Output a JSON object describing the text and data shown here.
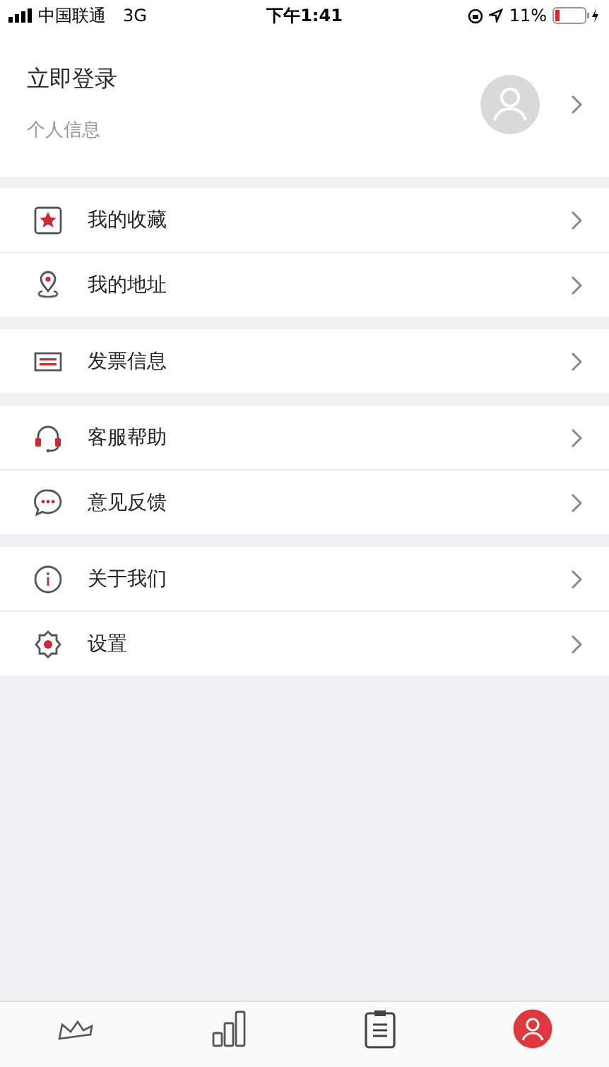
{
  "status_bar": {
    "carrier": "中国联通",
    "network": "3G",
    "time": "下午1:41",
    "battery": "11%"
  },
  "profile": {
    "title": "立即登录",
    "subtitle": "个人信息"
  },
  "groups": [
    {
      "items": [
        {
          "kind": "favorites",
          "label": "我的收藏"
        },
        {
          "kind": "address",
          "label": "我的地址"
        }
      ]
    },
    {
      "items": [
        {
          "kind": "invoice",
          "label": "发票信息"
        }
      ]
    },
    {
      "items": [
        {
          "kind": "support",
          "label": "客服帮助"
        },
        {
          "kind": "feedback",
          "label": "意见反馈"
        }
      ]
    },
    {
      "items": [
        {
          "kind": "about",
          "label": "关于我们"
        },
        {
          "kind": "settings",
          "label": "设置"
        }
      ]
    }
  ],
  "tab_bar": [
    {
      "kind": "home",
      "selected": false
    },
    {
      "kind": "data",
      "selected": false
    },
    {
      "kind": "tasks",
      "selected": false
    },
    {
      "kind": "me",
      "selected": true
    }
  ]
}
